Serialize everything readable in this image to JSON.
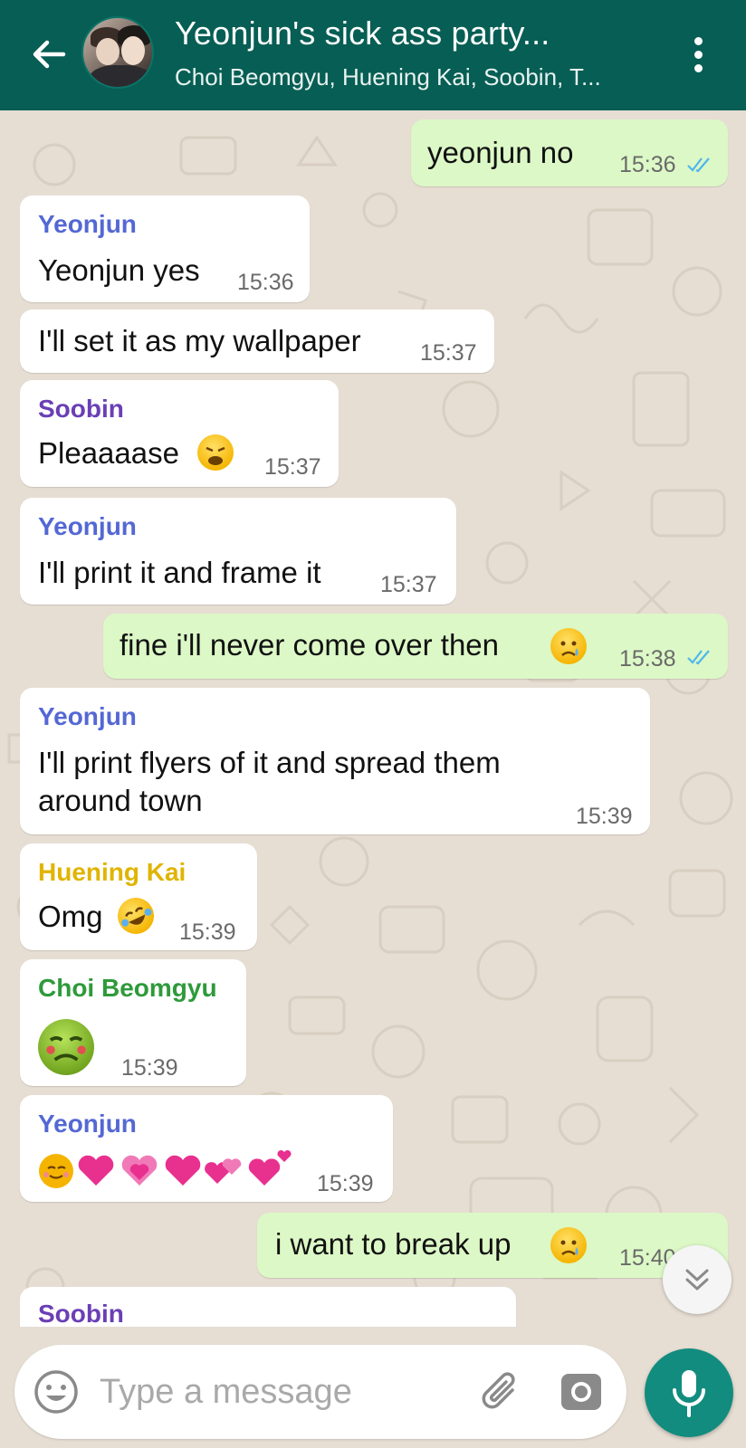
{
  "header": {
    "title": "Yeonjun's sick ass party...",
    "subtitle": "Choi Beomgyu, Huening Kai, Soobin, T..."
  },
  "messages": [
    {
      "type": "out",
      "text": "yeonjun no",
      "time": "15:36",
      "status": "read"
    },
    {
      "type": "in",
      "sender": "Yeonjun",
      "text": "Yeonjun yes",
      "time": "15:36"
    },
    {
      "type": "in",
      "text": "I'll set it as my wallpaper",
      "time": "15:37"
    },
    {
      "type": "in",
      "sender": "Soobin",
      "text": "Pleaaaase",
      "emoji": "weary-face",
      "time": "15:37"
    },
    {
      "type": "in",
      "sender": "Yeonjun",
      "text": "I'll print it and frame it",
      "time": "15:37"
    },
    {
      "type": "out",
      "text": "fine i'll never come over then",
      "emoji": "crying-face",
      "time": "15:38",
      "status": "read"
    },
    {
      "type": "in",
      "sender": "Yeonjun",
      "text_line1": "I'll print flyers of it and spread them",
      "text_line2": "around town",
      "time": "15:39"
    },
    {
      "type": "in",
      "sender": "Huening Kai",
      "text": "Omg",
      "emoji": "rolling-on-the-floor-laughing",
      "time": "15:39"
    },
    {
      "type": "in",
      "sender": "Choi Beomgyu",
      "emoji": "nauseated-face",
      "time": "15:39"
    },
    {
      "type": "in",
      "sender": "Yeonjun",
      "emoji": "smiling-face-and-hearts",
      "time": "15:39"
    },
    {
      "type": "out",
      "text": "i want to break up",
      "emoji": "crying-face",
      "time": "15:40",
      "status": "read"
    },
    {
      "type": "in",
      "sender": "Soobin"
    }
  ],
  "sender_colors": {
    "Yeonjun": "#5468d4",
    "Soobin": "#6a3fb5",
    "Huening Kai": "#e0b400",
    "Choi Beomgyu": "#2e9a3a"
  },
  "input": {
    "placeholder": "Type a message"
  },
  "colors": {
    "header": "#075e54",
    "outgoing": "#dcf8c6",
    "mic": "#128c7e",
    "read_ticks": "#4fb6ec"
  }
}
